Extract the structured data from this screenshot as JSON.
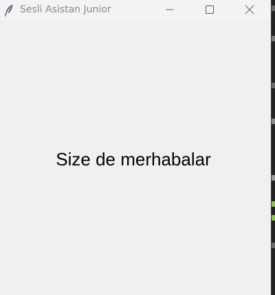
{
  "window": {
    "title": "Sesli Asistan Junior",
    "app_icon": "feather-icon",
    "controls": {
      "minimize_icon": "minimize-icon",
      "maximize_icon": "maximize-icon",
      "close_icon": "close-icon"
    }
  },
  "content": {
    "message": "Size de merhabalar"
  },
  "colors": {
    "window_background": "#f0f0f0",
    "titlebar_background": "#f3f3f3",
    "title_text": "#8a8a8a",
    "message_text": "#000000",
    "backdrop": "#1e1e1e"
  }
}
